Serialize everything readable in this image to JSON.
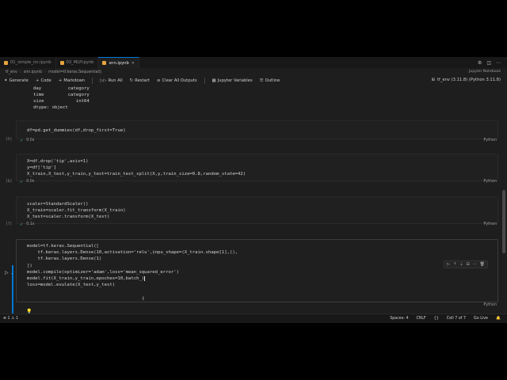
{
  "tabs": [
    {
      "label": "01_simple_nn.ipynb",
      "active": false
    },
    {
      "label": "03_MLP.ipynb",
      "active": false
    },
    {
      "label": "snn.ipynb",
      "active": true
    }
  ],
  "breadcrumb": [
    "tf_env",
    "snn.ipynb",
    "model=tf.keras.Sequential()"
  ],
  "kernel_hint": "Jupyter Notebook",
  "toolbar": {
    "generate": "Generate",
    "code": "Code",
    "markdown": "Markdown",
    "run_all": "Run All",
    "restart": "Restart",
    "clear_all": "Clear All Outputs",
    "variables": "Jupyter Variables",
    "outline": "Outline",
    "kernel": "tf_env (3.11.8) (Python 3.11.8)"
  },
  "cells": {
    "c1_output": [
      "day          category",
      "time         category",
      "size            int64",
      "dtype: object"
    ],
    "c2": {
      "exec": "[5]",
      "time": "0.0s",
      "lang": "Python",
      "code": "df=pd.get_dummies(df,drop_first=True)"
    },
    "c3": {
      "exec": "[6]",
      "time": "0.0s",
      "lang": "Python",
      "lines": [
        "X=df.drop('tip',axis=1)",
        "y=df['tip']",
        "X_train,X_test,y_train,y_test=train_test_split(X,y,train_size=0.8,random_state=42)"
      ]
    },
    "c4": {
      "exec": "[7]",
      "time": "0.1s",
      "lang": "Python",
      "lines": [
        "scaler=StandardScaler()",
        "X_train=scaler.fit_transform(X_train)",
        "X_test=scaler.transform(X_test)"
      ]
    },
    "c5": {
      "exec": "[ ]",
      "lang": "Python",
      "lines": [
        "model=tf.keras.Sequential([",
        "    tf.keras.layers.Dense(10,activation='relu',inpu_shape=(X_train.shape[1],)),",
        "    tf.keras.layers.Dense(1)",
        "])",
        "model.compile(optimizer='adam',loss='mean_squared_error')",
        "",
        "",
        "model.fit(X_train,y_train,epoches=10,batch_)",
        "loss=model.evulate(X_test,y_test)"
      ]
    }
  },
  "statusbar": {
    "errors": "⊗ 1 ⚠ 1",
    "spaces": "Spaces: 4",
    "crlf": "CRLF",
    "cell": "Cell 7 of 7",
    "golive": "Go Live"
  }
}
